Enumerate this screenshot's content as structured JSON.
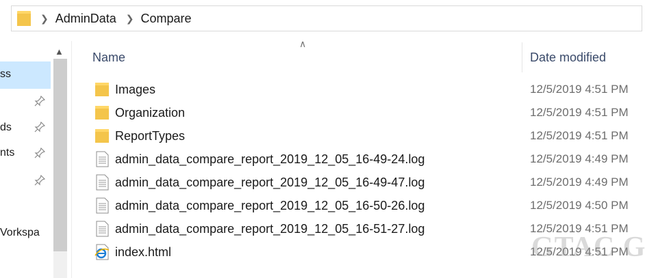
{
  "breadcrumb": [
    "AdminData",
    "Compare"
  ],
  "nav_items": [
    "ss",
    "ds",
    "nts",
    "Vorkspa"
  ],
  "columns": {
    "name": "Name",
    "date_modified": "Date modified"
  },
  "files": [
    {
      "name": "Images",
      "type": "folder",
      "date": "12/5/2019 4:51 PM"
    },
    {
      "name": "Organization",
      "type": "folder",
      "date": "12/5/2019 4:51 PM"
    },
    {
      "name": "ReportTypes",
      "type": "folder",
      "date": "12/5/2019 4:51 PM"
    },
    {
      "name": "admin_data_compare_report_2019_12_05_16-49-24.log",
      "type": "log",
      "date": "12/5/2019 4:49 PM"
    },
    {
      "name": "admin_data_compare_report_2019_12_05_16-49-47.log",
      "type": "log",
      "date": "12/5/2019 4:49 PM"
    },
    {
      "name": "admin_data_compare_report_2019_12_05_16-50-26.log",
      "type": "log",
      "date": "12/5/2019 4:50 PM"
    },
    {
      "name": "admin_data_compare_report_2019_12_05_16-51-27.log",
      "type": "log",
      "date": "12/5/2019 4:51 PM"
    },
    {
      "name": "index.html",
      "type": "html",
      "date": "12/5/2019 4:51 PM"
    }
  ],
  "watermark": "GTAC G",
  "colors": {
    "folder": "#f4c54b",
    "selection": "#cce8ff",
    "header_text": "#3a4a6a",
    "date_text": "#6d6d6d",
    "ie_blue": "#1e7fd6"
  }
}
